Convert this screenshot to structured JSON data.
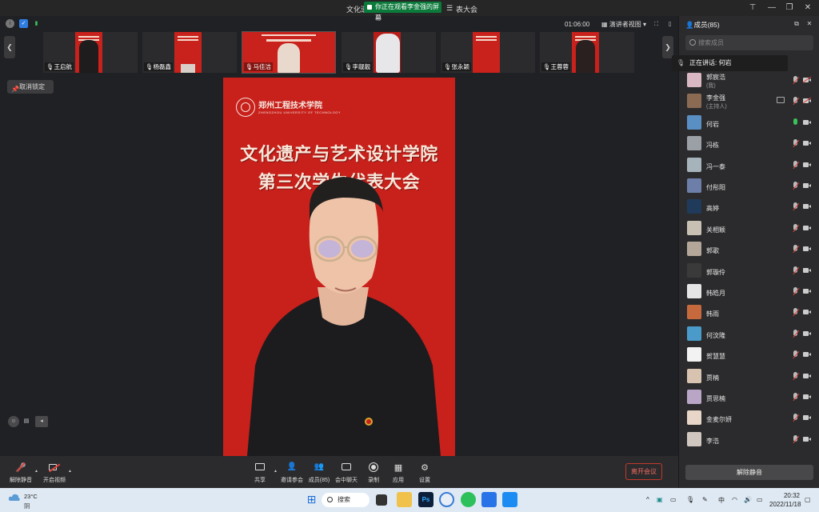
{
  "window": {
    "title_left": "文化遗",
    "share_notice": "你正在观看李金强的屏幕",
    "title_right": "表大会"
  },
  "toolbar": {
    "timer": "01:06:00",
    "view_mode": "演讲者视图"
  },
  "thumbnails": [
    {
      "name": "王启航",
      "poster": true
    },
    {
      "name": "杨磊鑫",
      "poster": true
    },
    {
      "name": "马佳洁",
      "poster": true
    },
    {
      "name": "李靓靓",
      "poster": false
    },
    {
      "name": "张永颖",
      "poster": true
    },
    {
      "name": "王蓉蓉",
      "poster": true
    }
  ],
  "stage": {
    "cancel_lock": "取消锁定",
    "university": "郑州工程技术学院",
    "university_en": "ZHENGZHOU UNIVERSITY OF TECHNOLOGY",
    "headline_1": "文化遗产与艺术设计学院",
    "headline_2": "第三次学生代表大会"
  },
  "bottom_bar": {
    "unmute": "解除静音",
    "start_video": "开启视频",
    "share": "共享",
    "invite": "邀请参会",
    "members": "成员(85)",
    "chat": "会中聊天",
    "record": "录制",
    "apps": "应用",
    "settings": "设置",
    "leave": "离开会议"
  },
  "sidebar": {
    "title": "成员(85)",
    "search_placeholder": "搜索成员",
    "speaking": "正在讲话: 何岩",
    "unmute_all": "解除静音",
    "members": [
      {
        "name": "郭宸浩",
        "sub": "(我)",
        "mic": "off",
        "cam": "off",
        "color": "#d9b8c4"
      },
      {
        "name": "李金强",
        "sub": "(主持人)",
        "mic": "off",
        "cam": "off",
        "share": true,
        "color": "#8a6a52"
      },
      {
        "name": "何岩",
        "mic": "on",
        "cam": "on",
        "color": "#5a8fc4"
      },
      {
        "name": "冯栋",
        "mic": "off",
        "cam": "on",
        "color": "#9aa0a6"
      },
      {
        "name": "冯一泰",
        "mic": "off",
        "cam": "on",
        "color": "#a7b3ba"
      },
      {
        "name": "付彤阳",
        "mic": "off",
        "cam": "on",
        "color": "#6d7fa8"
      },
      {
        "name": "高婷",
        "mic": "off",
        "cam": "on",
        "color": "#1f3a5a"
      },
      {
        "name": "关相颖",
        "mic": "off",
        "cam": "on",
        "color": "#c9c0b4"
      },
      {
        "name": "郭歌",
        "mic": "off",
        "cam": "on",
        "color": "#b4a79a"
      },
      {
        "name": "郭璇伶",
        "mic": "off",
        "cam": "on",
        "color": "#3a3a3a"
      },
      {
        "name": "韩皓月",
        "mic": "off",
        "cam": "on",
        "color": "#e6e6e6"
      },
      {
        "name": "韩雨",
        "mic": "off",
        "cam": "on",
        "color": "#c66a3e"
      },
      {
        "name": "何汶隆",
        "mic": "off",
        "cam": "on",
        "color": "#4a9bc9"
      },
      {
        "name": "贺慧慧",
        "mic": "off",
        "cam": "on",
        "color": "#f2f2f2"
      },
      {
        "name": "贾楠",
        "mic": "off",
        "cam": "on",
        "color": "#d8c3b0"
      },
      {
        "name": "贾思楠",
        "mic": "off",
        "cam": "on",
        "color": "#b9a5c6"
      },
      {
        "name": "金麦尔妍",
        "mic": "off",
        "cam": "on",
        "color": "#e8d6c8"
      },
      {
        "name": "李浩",
        "mic": "off",
        "cam": "on",
        "color": "#d0c8c0"
      }
    ]
  },
  "taskbar": {
    "temperature": "23°C",
    "weather": "阴",
    "search": "搜索",
    "ime": "中",
    "time": "20:32",
    "date": "2022/11/18"
  },
  "colors": {
    "stage_red": "#c8201b",
    "leave_red": "#c0392b",
    "share_green": "#0b7a3a"
  }
}
